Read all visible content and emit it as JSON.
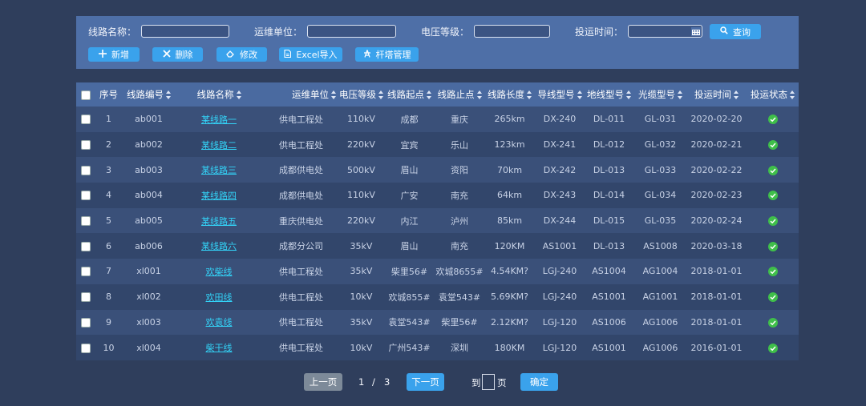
{
  "filters": {
    "line_name_label": "线路名称：",
    "unit_label": "运维单位：",
    "voltage_label": "电压等级：",
    "date_label": "投运时间：",
    "line_name_value": "",
    "unit_value": "",
    "voltage_value": "",
    "date_value": "",
    "query_label": "查询"
  },
  "toolbar": {
    "add_label": "新增",
    "delete_label": "删除",
    "edit_label": "修改",
    "excel_label": "Excel导入",
    "tower_label": "杆塔管理"
  },
  "table": {
    "headers": [
      "序号",
      "线路编号",
      "线路名称",
      "运维单位",
      "电压等级",
      "线路起点",
      "线路止点",
      "线路长度",
      "导线型号",
      "地线型号",
      "光缆型号",
      "投运时间",
      "投运状态"
    ],
    "rows": [
      [
        "1",
        "ab001",
        "某线路一",
        "供电工程处",
        "110kV",
        "成都",
        "重庆",
        "265km",
        "DX-240",
        "DL-011",
        "GL-031",
        "2020-02-20"
      ],
      [
        "2",
        "ab002",
        "某线路二",
        "供电工程处",
        "220kV",
        "宜宾",
        "乐山",
        "123km",
        "DX-241",
        "DL-012",
        "GL-032",
        "2020-02-21"
      ],
      [
        "3",
        "ab003",
        "某线路三",
        "成都供电处",
        "500kV",
        "眉山",
        "资阳",
        "70km",
        "DX-242",
        "DL-013",
        "GL-033",
        "2020-02-22"
      ],
      [
        "4",
        "ab004",
        "某线路四",
        "成都供电处",
        "110kV",
        "广安",
        "南充",
        "64km",
        "DX-243",
        "DL-014",
        "GL-034",
        "2020-02-23"
      ],
      [
        "5",
        "ab005",
        "某线路五",
        "重庆供电处",
        "220kV",
        "内江",
        "泸州",
        "85km",
        "DX-244",
        "DL-015",
        "GL-035",
        "2020-02-24"
      ],
      [
        "6",
        "ab006",
        "某线路六",
        "成都分公司",
        "35kV",
        "眉山",
        "南充",
        "120KM",
        "AS1001",
        "DL-013",
        "AS1008",
        "2020-03-18"
      ],
      [
        "7",
        "xl001",
        "欢柴线",
        "供电工程处",
        "35kV",
        "柴里56#",
        "欢城8655#",
        "4.54KM?",
        "LGJ-240",
        "AS1004",
        "AG1004",
        "2018-01-01"
      ],
      [
        "8",
        "xl002",
        "欢田线",
        "供电工程处",
        "10kV",
        "欢城855#",
        "袁堂543#",
        "5.69KM?",
        "LGJ-240",
        "AS1001",
        "AG1001",
        "2018-01-01"
      ],
      [
        "9",
        "xl003",
        "欢袁线",
        "供电工程处",
        "35kV",
        "袁堂543#",
        "柴里56#",
        "2.12KM?",
        "LGJ-120",
        "AS1006",
        "AG1006",
        "2018-01-01"
      ],
      [
        "10",
        "xl004",
        "柴干线",
        "供电工程处",
        "10kV",
        "广州543#",
        "深圳",
        "180KM",
        "LGJ-120",
        "AS1001",
        "AG1006",
        "2016-01-01"
      ]
    ],
    "status_icon": "check-circle-icon",
    "status_color": "#3fbf4a"
  },
  "pager": {
    "prev_label": "上一页",
    "current_page": "1",
    "separator": "/",
    "total_pages": "3",
    "next_label": "下一页",
    "goto_label": "到",
    "goto_value": "",
    "page_unit": "页",
    "confirm_label": "确定"
  },
  "colors": {
    "background": "#2f3e5c",
    "panel": "#4e6fa7",
    "button": "#3aa2ec",
    "link": "#33d3f7",
    "prev_disabled": "#7d8a99"
  }
}
